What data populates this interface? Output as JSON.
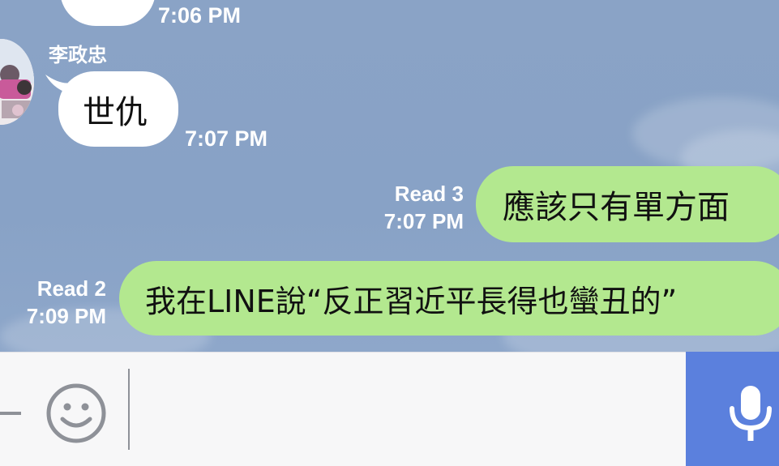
{
  "messages": [
    {
      "type": "incoming",
      "time": "7:06 PM"
    },
    {
      "type": "incoming",
      "sender": "李政忠",
      "text": "世仇",
      "time": "7:07 PM"
    },
    {
      "type": "outgoing",
      "text": "應該只有單方面",
      "read": "Read 3",
      "time": "7:07 PM"
    },
    {
      "type": "outgoing",
      "text": "我在LINE說“反正習近平長得也蠻丑的”",
      "read": "Read 2",
      "time": "7:09 PM"
    }
  ],
  "input_bar": {
    "text_value": "",
    "icons": [
      "plus-icon",
      "emoji-icon",
      "microphone-icon"
    ]
  },
  "colors": {
    "chat_background": "#8aa3c6",
    "outgoing_bubble": "#b3e88f",
    "incoming_bubble": "#ffffff",
    "mic_button": "#5b80dd",
    "input_bar": "#f7f7f8"
  }
}
